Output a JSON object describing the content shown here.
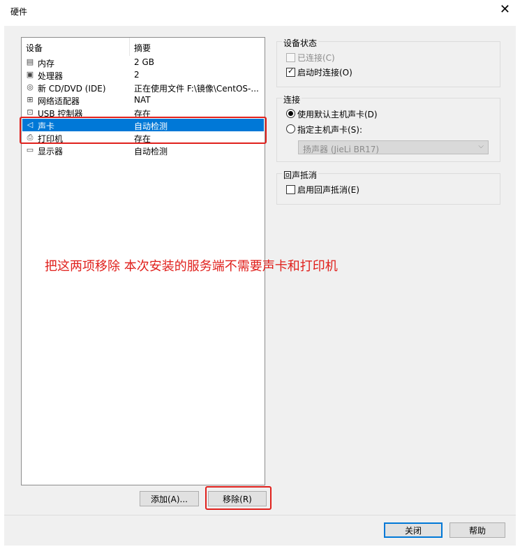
{
  "window": {
    "title": "硬件"
  },
  "device_list": {
    "col_device": "设备",
    "col_summary": "摘要",
    "rows": [
      {
        "icon": "memory-icon",
        "name": "内存",
        "summary": "2 GB"
      },
      {
        "icon": "cpu-icon",
        "name": "处理器",
        "summary": "2"
      },
      {
        "icon": "cd-icon",
        "name": "新 CD/DVD (IDE)",
        "summary": "正在使用文件 F:\\镜像\\CentOS-..."
      },
      {
        "icon": "network-icon",
        "name": "网络适配器",
        "summary": "NAT"
      },
      {
        "icon": "usb-icon",
        "name": "USB 控制器",
        "summary": "存在"
      },
      {
        "icon": "speaker-icon",
        "name": "声卡",
        "summary": "自动检测"
      },
      {
        "icon": "printer-icon",
        "name": "打印机",
        "summary": "存在"
      },
      {
        "icon": "monitor-icon",
        "name": "显示器",
        "summary": "自动检测"
      }
    ],
    "selected_index": 5
  },
  "annotation": "把这两项移除 本次安装的服务端不需要声卡和打印机",
  "buttons": {
    "add": "添加(A)...",
    "remove": "移除(R)",
    "close": "关闭",
    "help": "帮助"
  },
  "device_status": {
    "title": "设备状态",
    "connected": {
      "label": "已连接(C)",
      "checked": false,
      "enabled": false
    },
    "connect_at_power_on": {
      "label": "启动时连接(O)",
      "checked": true
    }
  },
  "connection": {
    "title": "连接",
    "use_default": {
      "label": "使用默认主机声卡(D)",
      "selected": true
    },
    "specify": {
      "label": "指定主机声卡(S):",
      "selected": false
    },
    "selected_device": "扬声器 (JieLi BR17)"
  },
  "echo_cancel": {
    "title": "回声抵消",
    "enable": {
      "label": "启用回声抵消(E)",
      "checked": false
    }
  },
  "colors": {
    "selection": "#0078d7",
    "annotation": "#e0201c"
  }
}
